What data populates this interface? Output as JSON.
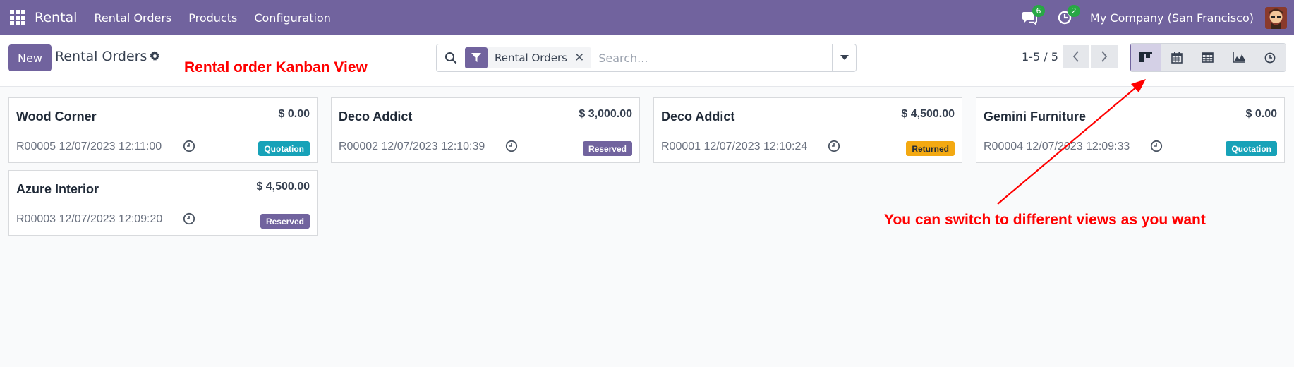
{
  "navbar": {
    "app_name": "Rental",
    "menus": [
      "Rental Orders",
      "Products",
      "Configuration"
    ],
    "messages_count": "6",
    "activities_count": "2",
    "company": "My Company (San Francisco)"
  },
  "control": {
    "new_label": "New",
    "title": "Rental Orders",
    "facet_label": "Rental Orders",
    "search_placeholder": "Search...",
    "pager": "1-5 / 5"
  },
  "annotations": {
    "kanban_note": "Rental order Kanban View",
    "switch_note": "You can switch to different views as you want"
  },
  "views": [
    "kanban",
    "calendar",
    "pivot",
    "graph",
    "activity"
  ],
  "active_view": "kanban",
  "orders": [
    {
      "partner": "Wood Corner",
      "amount": "$ 0.00",
      "ref": "R00005 12/07/2023 12:11:00",
      "state": "Quotation",
      "state_color": "#17a2b8"
    },
    {
      "partner": "Deco Addict",
      "amount": "$ 3,000.00",
      "ref": "R00002 12/07/2023 12:10:39",
      "state": "Reserved",
      "state_color": "#71639e"
    },
    {
      "partner": "Deco Addict",
      "amount": "$ 4,500.00",
      "ref": "R00001 12/07/2023 12:10:24",
      "state": "Returned",
      "state_color": "#f3a912"
    },
    {
      "partner": "Gemini Furniture",
      "amount": "$ 0.00",
      "ref": "R00004 12/07/2023 12:09:33",
      "state": "Quotation",
      "state_color": "#17a2b8"
    },
    {
      "partner": "Azure Interior",
      "amount": "$ 4,500.00",
      "ref": "R00003 12/07/2023 12:09:20",
      "state": "Reserved",
      "state_color": "#71639e"
    }
  ]
}
